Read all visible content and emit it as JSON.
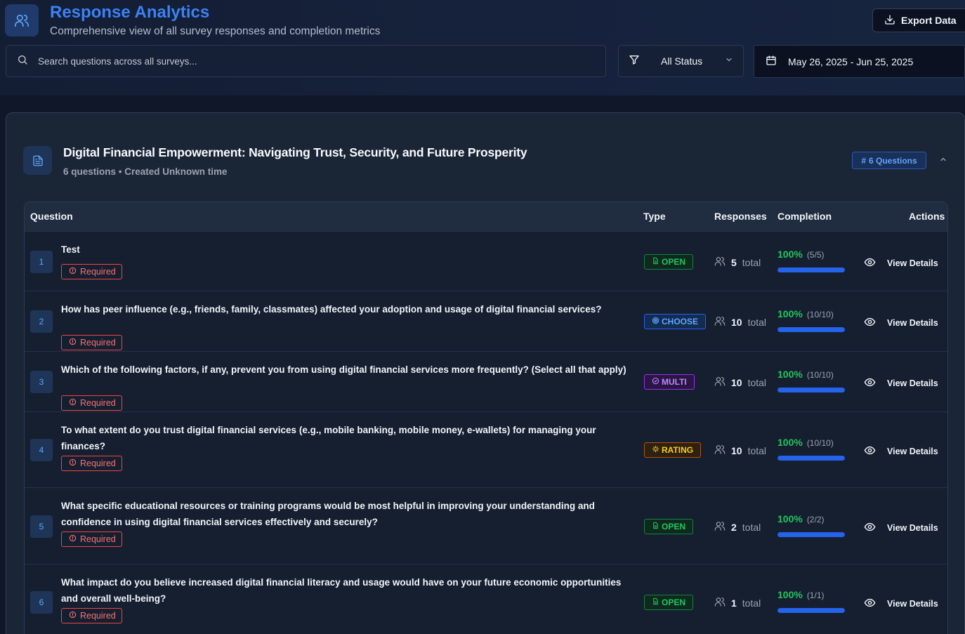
{
  "header": {
    "title": "Response Analytics",
    "subtitle": "Comprehensive view of all survey responses and completion metrics",
    "export_label": "Export Data"
  },
  "filters": {
    "search_placeholder": "Search questions across all surveys...",
    "status_value": "All Status",
    "date_range": "May 26, 2025 - Jun 25, 2025"
  },
  "survey": {
    "title": "Digital Financial Empowerment: Navigating Trust, Security, and Future Prosperity",
    "meta": "6 questions • Created Unknown time",
    "questions_badge": "6 Questions"
  },
  "table": {
    "columns": {
      "question": "Question",
      "type": "Type",
      "responses": "Responses",
      "completion": "Completion",
      "actions": "Actions"
    },
    "required_label": "Required",
    "total_label": "total",
    "view_label": "View Details",
    "rows": [
      {
        "num": "1",
        "text": "Test",
        "type": "OPEN",
        "responses": "5",
        "pct": "100%",
        "frac": "(5/5)",
        "completion": 1.0
      },
      {
        "num": "2",
        "text": "How has peer influence (e.g., friends, family, classmates) affected your adoption and usage of digital financial services?",
        "type": "CHOOSE",
        "responses": "10",
        "pct": "100%",
        "frac": "(10/10)",
        "completion": 1.0
      },
      {
        "num": "3",
        "text": "Which of the following factors, if any, prevent you from using digital financial services more frequently? (Select all that apply)",
        "type": "MULTI",
        "responses": "10",
        "pct": "100%",
        "frac": "(10/10)",
        "completion": 1.0
      },
      {
        "num": "4",
        "text": "To what extent do you trust digital financial services (e.g., mobile banking, mobile money, e-wallets) for managing your finances?",
        "type": "RATING",
        "responses": "10",
        "pct": "100%",
        "frac": "(10/10)",
        "completion": 1.0
      },
      {
        "num": "5",
        "text": "What specific educational resources or training programs would be most helpful in improving your understanding and confidence in using digital financial services effectively and securely?",
        "type": "OPEN",
        "responses": "2",
        "pct": "100%",
        "frac": "(2/2)",
        "completion": 1.0
      },
      {
        "num": "6",
        "text": "What impact do you believe increased digital financial literacy and usage would have on your future economic opportunities and overall well-being?",
        "type": "OPEN",
        "responses": "1",
        "pct": "100%",
        "frac": "(1/1)",
        "completion": 1.0
      }
    ]
  },
  "colors": {
    "accent": "#3b82f6",
    "open": "#22c55e",
    "choose": "#60a5fa",
    "multi": "#c084fc",
    "rating": "#facc15",
    "required": "#f87171"
  },
  "icons": {
    "app": "users-icon",
    "export": "download-icon",
    "search": "search-icon",
    "filter": "filter-icon",
    "calendar": "calendar-icon",
    "survey": "document-icon",
    "collapse": "chevron-up-icon",
    "responses": "users-icon",
    "view": "eye-icon"
  }
}
